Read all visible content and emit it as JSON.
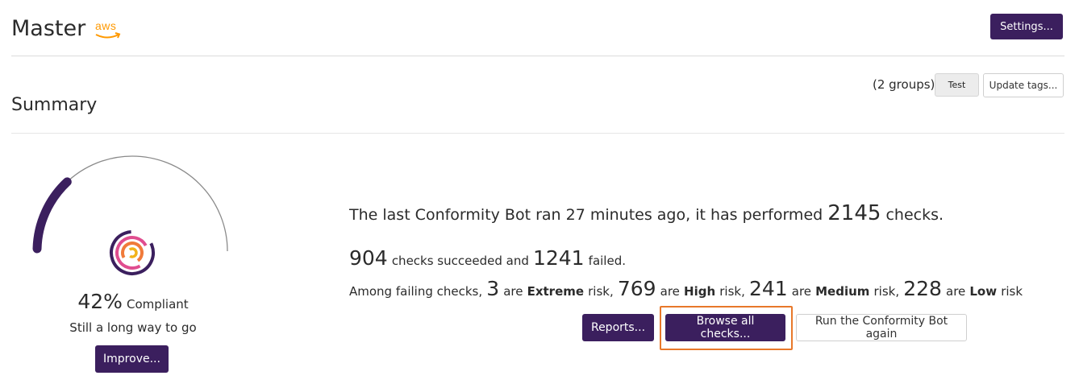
{
  "header": {
    "title": "Master",
    "provider_logo": "aws",
    "settings_label": "Settings..."
  },
  "toolbar": {
    "groups_text": "(2 groups)",
    "tag_label": "Test",
    "update_tags_label": "Update tags..."
  },
  "summary": {
    "heading": "Summary",
    "compliance": {
      "percent_text": "42%",
      "percent_value": 42,
      "label": "Compliant",
      "subtitle": "Still a long way to go",
      "improve_label": "Improve...",
      "logo_icon": "conformity-logo-icon"
    },
    "stats": {
      "line1_prefix": "The last Conformity Bot ran 27 minutes ago, it has performed",
      "total_checks": "2145",
      "line1_suffix": "checks.",
      "succeeded": "904",
      "succeeded_text": "checks succeeded and",
      "failed": "1241",
      "failed_text": "failed.",
      "among_text": "Among failing checks,",
      "extreme": "3",
      "extreme_label": "Extreme",
      "high": "769",
      "high_label": "High",
      "medium": "241",
      "medium_label": "Medium",
      "low": "228",
      "low_label": "Low",
      "are": "are",
      "risk": "risk,",
      "risk_last": "risk"
    },
    "actions": {
      "reports_label": "Reports...",
      "browse_label": "Browse all checks...",
      "run_label": "Run the Conformity Bot again"
    }
  },
  "colors": {
    "brand_purple": "#3b1f5e",
    "highlight_orange": "#e8782a",
    "aws_orange": "#ff9900"
  }
}
